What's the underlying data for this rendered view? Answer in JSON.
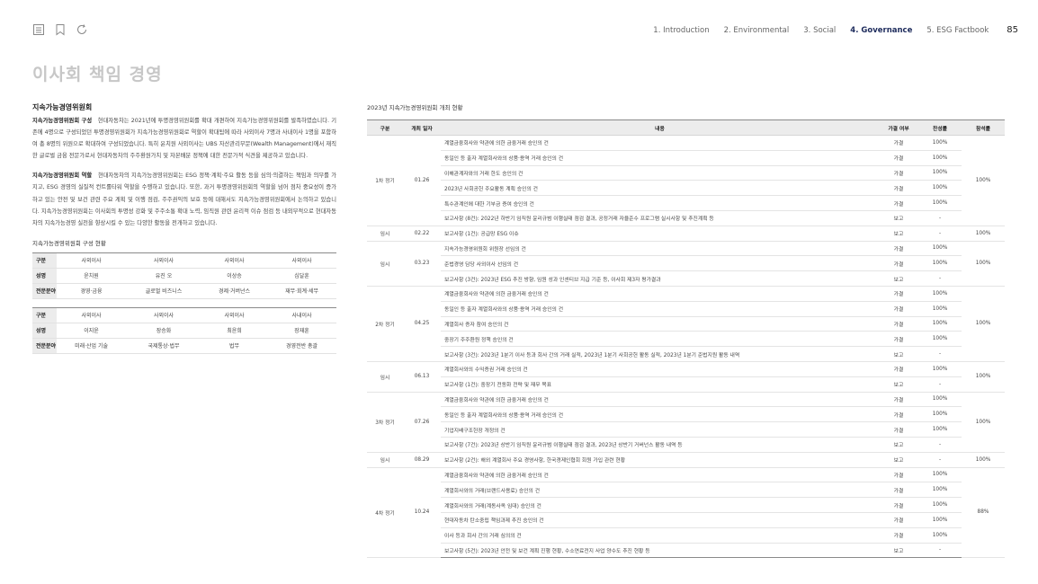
{
  "nav": {
    "items": [
      "1. Introduction",
      "2. Environmental",
      "3. Social",
      "4. Governance",
      "5. ESG Factbook"
    ],
    "active_index": 3,
    "page_number": "85"
  },
  "page_title": "이사회 책임 경영",
  "left": {
    "section_title": "지속가능경영위원회",
    "para1_label": "지속가능경영위원회 구성",
    "para1_text": "현대자동차는 2021년에 투명경영위원회를 확대 개편하여 지속가능경영위원회를 발족하였습니다. 기존에 4명으로 구성되었던 투명경영위원회가 지속가능경영위원회로 역할이 확대됨에 따라 사외이사 7명과 사내이사 1명을 포함하여 총 8명의 위원으로 확대하여 구성되었습니다. 특히 윤치원 사외이사는 UBS 자산관리부문(Wealth Management)에서 재직한 글로벌 금융 전문가로서 현대자동차의 주주환원가치 및 자본배분 정책에 대한 전문가적 식견을 제공하고 있습니다.",
    "para2_label": "지속가능경영위원회 역할",
    "para2_text": "현대자동차의 지속가능경영위원회는 ESG 정책·계획·주요 활동 등을 심의·의결하는 책임과 의무를 가지고, ESG 경영의 실질적 컨트롤타워 역할을 수행하고 있습니다. 또한, 과거 투명경영위원회의 역할을 넘어 점차 중요성이 증가하고 있는 안전 및 보건 관련 주요 계획 및 이행 점검, 주주권익의 보호 등에 대해서도 지속가능경영위원회에서 논의하고 있습니다. 지속가능경영위원회는 이사회의 투명성 강화 및 주주소통 확대 노력, 임직원 관련 윤리적 이슈 점검 등 내외부적으로 현대자동차의 지속가능경영 실천을 향상시킬 수 있는 다양한 활동을 전개하고 있습니다.",
    "composition_title": "지속가능경영위원회 구성 현황",
    "row_labels": {
      "type": "구분",
      "name": "성명",
      "field": "전문분야"
    },
    "group1": {
      "type": [
        "사외이사",
        "사외이사",
        "사외이사",
        "사외이사"
      ],
      "name": [
        "윤치원",
        "유진 오",
        "이상승",
        "심달훈"
      ],
      "field": [
        "경영·금융",
        "글로벌 비즈니스",
        "경제·거버넌스",
        "재무·회계·세무"
      ]
    },
    "group2": {
      "type": [
        "사외이사",
        "사외이사",
        "사외이사",
        "사내이사"
      ],
      "name": [
        "이지윤",
        "장승화",
        "최윤희",
        "장재훈"
      ],
      "field": [
        "미래·산업 기술",
        "국제통상·법무",
        "법무",
        "경영전반 총괄"
      ]
    }
  },
  "right": {
    "table_title": "2023년 지속가능경영위원회 개최 현황",
    "headers": [
      "구분",
      "개최 일자",
      "내용",
      "가결 여부",
      "찬성률",
      "참석률"
    ],
    "meetings": [
      {
        "type": "1차 정기",
        "date": "01.26",
        "attendance": "100%",
        "items": [
          [
            "계열금융회사와 약관에 의한 금융거래 승인의 건",
            "가결",
            "100%"
          ],
          [
            "동일인 등 출자 계열회사와의 상품·용역 거래 승인의 건",
            "가결",
            "100%"
          ],
          [
            "이해관계자와의 거래 한도 승인의 건",
            "가결",
            "100%"
          ],
          [
            "2023년 사회공헌 주요활동 계획 승인의 건",
            "가결",
            "100%"
          ],
          [
            "특수관계인에 대한 기부금 증여 승인의 건",
            "가결",
            "100%"
          ],
          [
            "보고사항 (8건): 2022년 하반기 임직원 윤리규범 이행실태 점검 결과, 공정거래 자율준수 프로그램 실시사항 및 추진계획 등",
            "보고",
            "-"
          ]
        ]
      },
      {
        "type": "임시",
        "date": "02.22",
        "attendance": "100%",
        "items": [
          [
            "보고사항 (1건): 공급망 ESG 이슈",
            "보고",
            "-"
          ]
        ]
      },
      {
        "type": "임시",
        "date": "03.23",
        "attendance": "100%",
        "items": [
          [
            "지속가능경영위원회 위원장 선임의 건",
            "가결",
            "100%"
          ],
          [
            "준법경영 담당 사외이사 선임의 건",
            "가결",
            "100%"
          ],
          [
            "보고사항 (3건): 2023년 ESG 추진 방향, 임원 성과 인센티브 지급 기준 등, 이사회 제3자 평가결과",
            "보고",
            "-"
          ]
        ]
      },
      {
        "type": "2차 정기",
        "date": "04.25",
        "attendance": "100%",
        "items": [
          [
            "계열금융회사와 약관에 의한 금융거래 승인의 건",
            "가결",
            "100%"
          ],
          [
            "동일인 등 출자 계열회사와의 상품·용역 거래 승인의 건",
            "가결",
            "100%"
          ],
          [
            "계열회사 증자 참여 승인의 건",
            "가결",
            "100%"
          ],
          [
            "중장기 주주환원 정책 승인의 건",
            "가결",
            "100%"
          ],
          [
            "보고사항 (3건): 2023년 1분기 이사 등과 회사 간의 거래 실적, 2023년 1분기 사회공헌 활동 실적, 2023년 1분기 준법지원 활동 내역",
            "보고",
            "-"
          ]
        ]
      },
      {
        "type": "임시",
        "date": "06.13",
        "attendance": "100%",
        "items": [
          [
            "계열회사와의 수익증권 거래 승인의 건",
            "가결",
            "100%"
          ],
          [
            "보고사항 (1건): 중장기 전동화 전략 및 재무 목표",
            "보고",
            "-"
          ]
        ]
      },
      {
        "type": "3차 정기",
        "date": "07.26",
        "attendance": "100%",
        "items": [
          [
            "계열금융회사와 약관에 의한 금융거래 승인의 건",
            "가결",
            "100%"
          ],
          [
            "동일인 등 출자 계열회사와의 상품·용역 거래 승인의 건",
            "가결",
            "100%"
          ],
          [
            "기업지배구조헌장 개정의 건",
            "가결",
            "100%"
          ],
          [
            "보고사항 (7건): 2023년 상반기 임직원 윤리규범 이행실태 점검 결과, 2023년 상반기 거버넌스 활동 내역 등",
            "보고",
            "-"
          ]
        ]
      },
      {
        "type": "임시",
        "date": "08.29",
        "attendance": "100%",
        "items": [
          [
            "보고사항 (2건): 해외 계열회사 주요 경영사항, 한국경제인협회 회원 가입 관련 현황",
            "보고",
            "-"
          ]
        ]
      },
      {
        "type": "4차 정기",
        "date": "10.24",
        "attendance": "88%",
        "items": [
          [
            "계열금융회사와 약관에 의한 금융거래 승인의 건",
            "가결",
            "100%"
          ],
          [
            "계열회사와의 거래(브랜드사용료) 승인의 건",
            "가결",
            "100%"
          ],
          [
            "계열회사와의 거래(계동사옥 임대) 승인의 건",
            "가결",
            "100%"
          ],
          [
            "현대자동차 탄소중립 책임과제 추진 승인의 건",
            "가결",
            "100%"
          ],
          [
            "이사 등과 회사 간의 거래 심의의 건",
            "가결",
            "100%"
          ],
          [
            "보고사항 (5건): 2023년 안전 및 보건 계획 진행 현황, 수소연료전지 사업 양수도 추진 현황 등",
            "보고",
            "-"
          ]
        ]
      }
    ]
  }
}
